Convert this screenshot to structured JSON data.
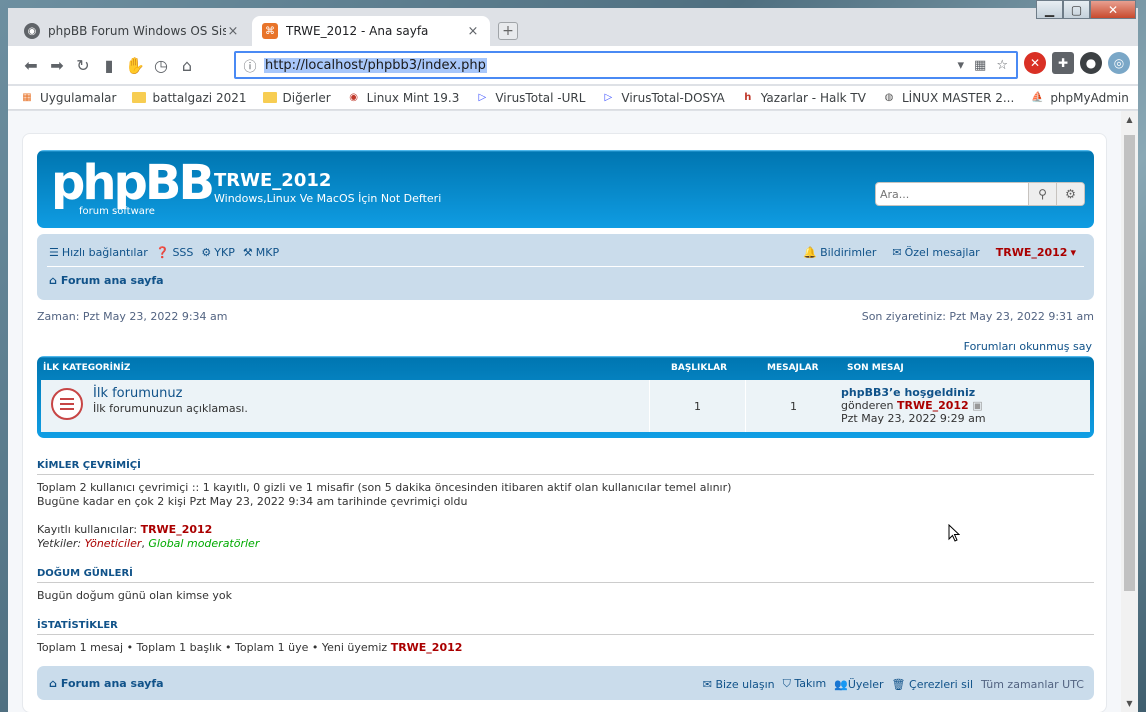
{
  "tabs": [
    {
      "title": "phpBB Forum Windows OS Sisten",
      "close": "×"
    },
    {
      "title": "TRWE_2012 - Ana sayfa",
      "close": "×"
    }
  ],
  "newtab": "+",
  "address": {
    "url": "http://localhost/phpbb3/index.php"
  },
  "bookmarks": [
    {
      "label": "Uygulamalar"
    },
    {
      "label": "battalgazi 2021"
    },
    {
      "label": "Diğerler"
    },
    {
      "label": "Linux Mint 19.3"
    },
    {
      "label": "VirusTotal -URL"
    },
    {
      "label": "VirusTotal-DOSYA"
    },
    {
      "label": "Yazarlar - Halk TV"
    },
    {
      "label": "LİNUX MASTER 2..."
    },
    {
      "label": "phpMyAdmin"
    }
  ],
  "site": {
    "logo_big": "phpBB",
    "logo_small": "forum  software",
    "name": "TRWE_2012",
    "description": "Windows,Linux Ve MacOS İçin Not Defteri",
    "search_placeholder": "Ara..."
  },
  "navbar": {
    "quick_links": "Hızlı bağlantılar",
    "faq": "SSS",
    "ykp": "YKP",
    "mkp": "MKP",
    "notifications": "Bildirimler",
    "pm": "Özel mesajlar",
    "user": "TRWE_2012",
    "home": "Forum ana sayfa"
  },
  "time": {
    "now": "Zaman: Pzt May 23, 2022 9:34 am",
    "last_visit": "Son ziyaretiniz: Pzt May 23, 2022 9:31 am"
  },
  "mark_read": "Forumları okunmuş say",
  "category": {
    "title": "İLK KATEGORİNİZ",
    "col_topics": "BAŞLIKLAR",
    "col_posts": "MESAJLAR",
    "col_last": "SON MESAJ"
  },
  "forum": {
    "title": "İlk forumunuz",
    "description": "İlk forumunuzun açıklaması.",
    "topics": "1",
    "posts": "1",
    "last_title": "phpBB3’e hoşgeldiniz",
    "last_by_prefix": "gönderen",
    "last_by": "TRWE_2012",
    "last_date": "Pzt May 23, 2022 9:29 am"
  },
  "online": {
    "heading": "KİMLER ÇEVRİMİÇİ",
    "line1": "Toplam 2 kullanıcı çevrimiçi :: 1 kayıtlı, 0 gizli ve 1 misafir (son 5 dakika öncesinden itibaren aktif olan kullanıcılar temel alınır)",
    "line2": "Bugüne kadar en çok 2 kişi Pzt May 23, 2022 9:34 am tarihinde çevrimiçi oldu",
    "registered_prefix": "Kayıtlı kullanıcılar:",
    "registered_user": "TRWE_2012",
    "legend_prefix": "Yetkiler:",
    "admins": "Yöneticiler",
    "globalmods": "Global moderatörler"
  },
  "birthdays": {
    "heading": "DOĞUM GÜNLERİ",
    "text": "Bugün doğum günü olan kimse yok"
  },
  "stats": {
    "heading": "İSTATİSTİKLER",
    "text_prefix": "Toplam 1 mesaj • Toplam 1 başlık • Toplam 1 üye • Yeni üyemiz",
    "newest": "TRWE_2012"
  },
  "footer": {
    "home": "Forum ana sayfa",
    "contact": "Bize ulaşın",
    "team": "Takım",
    "members": "Üyeler",
    "cookies": "Çerezleri sil",
    "timezone": "Tüm zamanlar UTC"
  },
  "colors": {
    "accent": "#12a3eb",
    "link": "#105289",
    "user": "#aa0000"
  }
}
